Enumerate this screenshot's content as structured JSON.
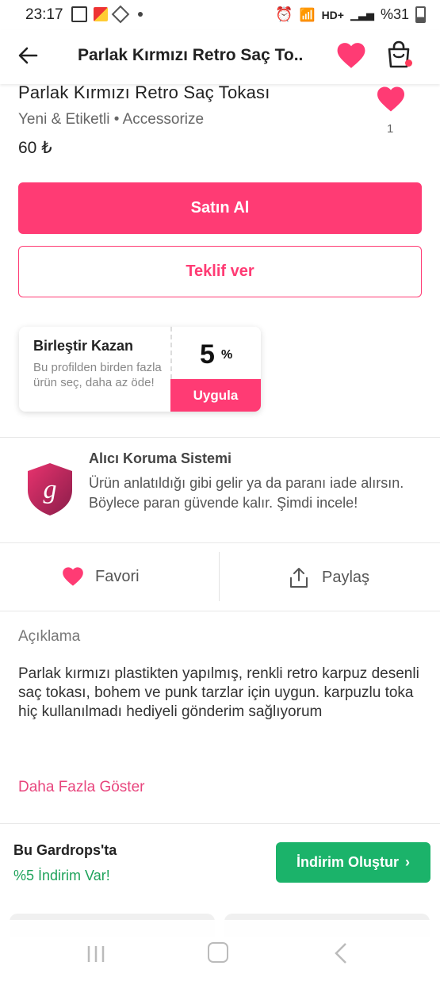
{
  "status_bar": {
    "time": "23:17",
    "network": "HD+",
    "battery": "%31"
  },
  "header": {
    "title": "Parlak Kırmızı Retro Saç To..",
    "accent_color": "#ff3b74"
  },
  "product": {
    "title": "Parlak Kırmızı Retro Saç Tokası",
    "subtitle": "Yeni & Etiketli • Accessorize",
    "price": "60 ₺",
    "like_count": "1"
  },
  "actions": {
    "buy_label": "Satın Al",
    "offer_label": "Teklif ver"
  },
  "bundle": {
    "title": "Birleştir Kazan",
    "description": "Bu profilden birden fazla ürün seç, daha az öde!",
    "discount": "5",
    "percent_sign": "%",
    "apply_label": "Uygula"
  },
  "protection": {
    "title": "Alıcı Koruma Sistemi",
    "description": "Ürün anlatıldığı gibi gelir ya da paranı iade alırsın. Böylece paran güvende kalır. Şimdi incele!",
    "logo_letter": "g"
  },
  "social": {
    "favorite_label": "Favori",
    "share_label": "Paylaş"
  },
  "description": {
    "label": "Açıklama",
    "text": "Parlak kırmızı plastikten yapılmış, renkli retro karpuz desenli saç tokası, bohem ve punk tarzlar için uygun. karpuzlu toka hiç kullanılmadı hediyeli gönderim sağlıyorum",
    "show_more_label": "Daha Fazla Göster"
  },
  "gardrops": {
    "title": "Bu Gardrops'ta",
    "subtitle": "%5 İndirim Var!",
    "button_label": "İndirim Oluştur",
    "button_color": "#1bb36a"
  }
}
